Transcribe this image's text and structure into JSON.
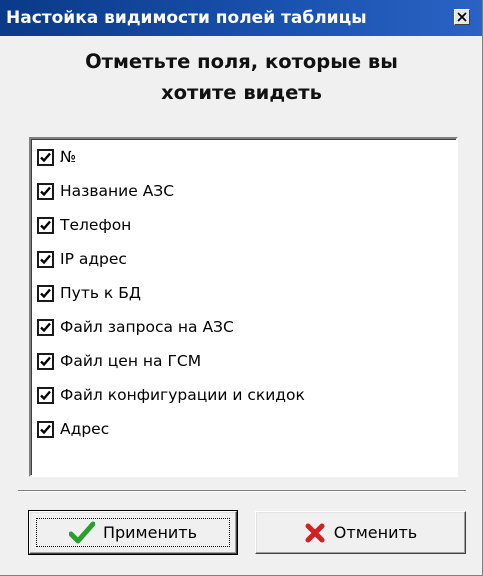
{
  "window": {
    "title": "Настойка видимости полей таблицы",
    "heading_line1": "Отметьте поля, которые вы",
    "heading_line2": "хотите  видеть"
  },
  "fields": [
    {
      "label": "№",
      "checked": true
    },
    {
      "label": "Название АЗС",
      "checked": true
    },
    {
      "label": "Телефон",
      "checked": true
    },
    {
      "label": "IP адрес",
      "checked": true
    },
    {
      "label": "Путь к БД",
      "checked": true
    },
    {
      "label": "Файл запроса на АЗС",
      "checked": true
    },
    {
      "label": "Файл цен на ГСМ",
      "checked": true
    },
    {
      "label": "Файл конфигурации и скидок",
      "checked": true
    },
    {
      "label": "Адрес",
      "checked": true
    }
  ],
  "buttons": {
    "apply_label": "Применить",
    "cancel_label": "Отменить"
  },
  "icons": {
    "apply": "checkmark-icon",
    "cancel": "cross-icon",
    "close": "close-icon"
  },
  "colors": {
    "titlebar": "#0a3a88",
    "apply_icon": "#2aa02a",
    "cancel_icon": "#d42020"
  }
}
